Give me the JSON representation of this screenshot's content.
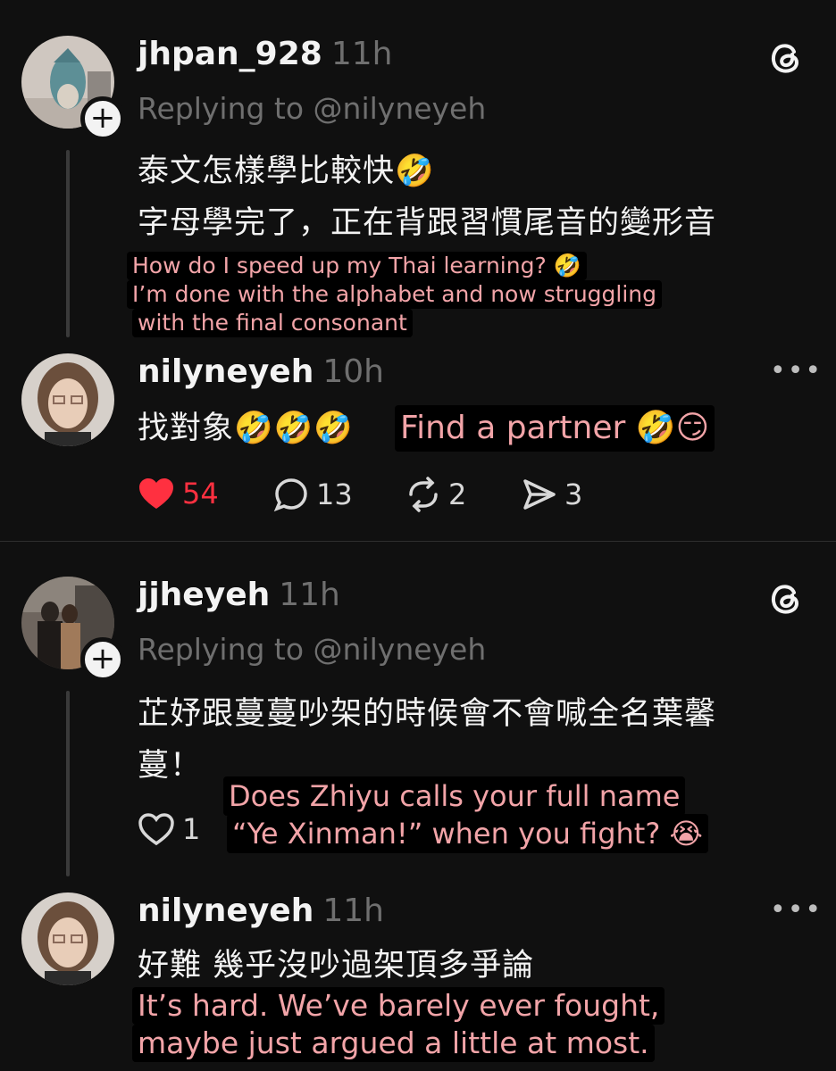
{
  "posts": [
    {
      "username": "jhpan_928",
      "time": "11h",
      "reply_to": "Replying to @nilyneyeh",
      "lines": [
        "泰文怎樣學比較快🤣",
        "字母學完了，正在背跟習慣尾音的變形音"
      ],
      "translation": [
        "How do I speed up my Thai learning? 🤣",
        "I’m done with the alphabet and now struggling",
        "with the final consonant"
      ]
    },
    {
      "username": "nilyneyeh",
      "time": "10h",
      "text": "找對象🤣🤣🤣",
      "translation": "Find a partner 🤣😏",
      "likes": "54",
      "comments": "13",
      "reposts": "2",
      "shares": "3"
    },
    {
      "username": "jjheyeh",
      "time": "11h",
      "reply_to": "Replying to @nilyneyeh",
      "lines": [
        "芷妤跟蔓蔓吵架的時候會不會喊全名葉馨",
        "蔓！"
      ],
      "likes": "1",
      "translation": [
        "Does Zhiyu calls your full name",
        "“Ye Xinman!” when you fight? 😭"
      ]
    },
    {
      "username": "nilyneyeh",
      "time": "11h",
      "text": "好難 幾乎沒吵過架頂多爭論",
      "translation": [
        "It’s hard. We’ve barely ever fought,",
        "maybe just argued a little at most."
      ]
    }
  ],
  "colors": {
    "background": "#101010",
    "like_red": "#ff3040",
    "translation_text": "#f2a4a8",
    "muted": "#6f6f6f"
  },
  "icons": [
    "threads-logo-icon",
    "more-icon",
    "heart-icon",
    "comment-icon",
    "repost-icon",
    "share-icon",
    "follow-plus-icon"
  ]
}
